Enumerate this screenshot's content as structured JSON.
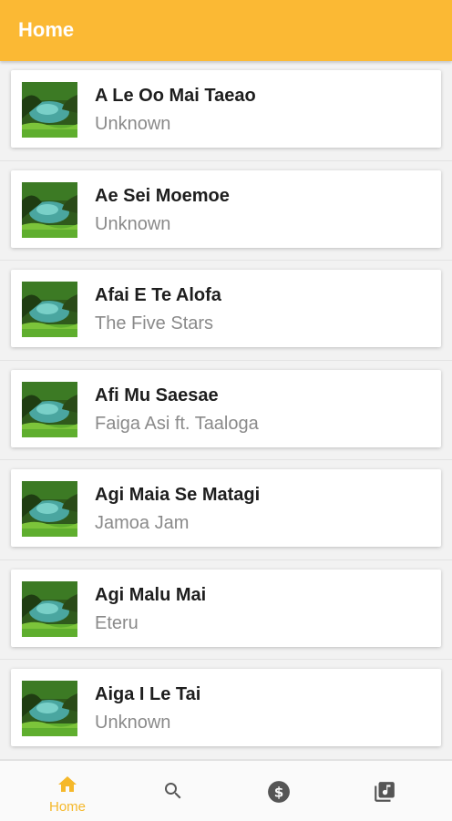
{
  "appbar": {
    "title": "Home"
  },
  "songs": [
    {
      "title": "A Le Oo Mai Taeao",
      "artist": "Unknown"
    },
    {
      "title": "Ae Sei Moemoe",
      "artist": "Unknown"
    },
    {
      "title": "Afai E Te Alofa",
      "artist": "The Five Stars"
    },
    {
      "title": "Afi Mu Saesae",
      "artist": "Faiga Asi ft. Taaloga"
    },
    {
      "title": "Agi Maia Se Matagi",
      "artist": "Jamoa Jam"
    },
    {
      "title": "Agi Malu Mai",
      "artist": "Eteru"
    },
    {
      "title": "Aiga I Le Tai",
      "artist": "Unknown"
    }
  ],
  "nav": {
    "home_label": "Home",
    "items": [
      {
        "icon": "home-icon",
        "active": true
      },
      {
        "icon": "search-icon",
        "active": false
      },
      {
        "icon": "dollar-icon",
        "active": false
      },
      {
        "icon": "music-library-icon",
        "active": false
      }
    ]
  },
  "colors": {
    "accent": "#fbb934",
    "nav_active": "#f5b82a",
    "nav_inactive": "#555555"
  }
}
